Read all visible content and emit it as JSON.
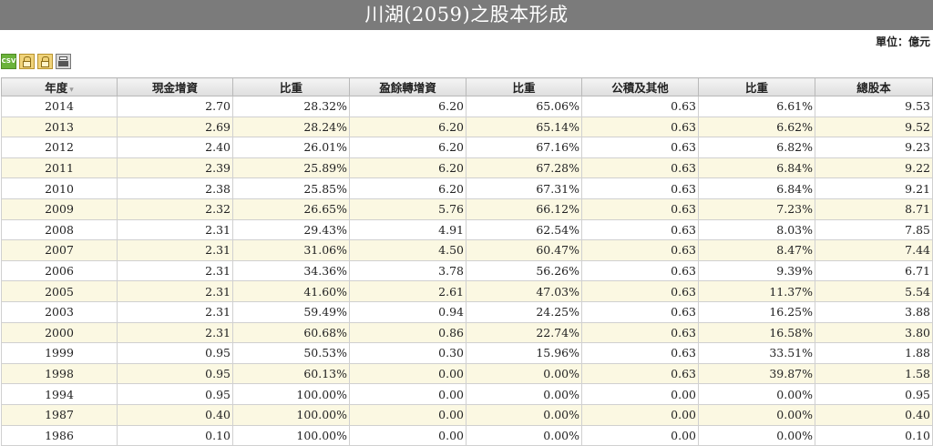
{
  "title": "川湖(2059)之股本形成",
  "unit": "單位：億元",
  "toolbar": {
    "csv_label": "CSV"
  },
  "columns": [
    "年度",
    "現金增資",
    "比重",
    "盈餘轉增資",
    "比重",
    "公積及其他",
    "比重",
    "總股本"
  ],
  "rows": [
    [
      "2014",
      "2.70",
      "28.32%",
      "6.20",
      "65.06%",
      "0.63",
      "6.61%",
      "9.53"
    ],
    [
      "2013",
      "2.69",
      "28.24%",
      "6.20",
      "65.14%",
      "0.63",
      "6.62%",
      "9.52"
    ],
    [
      "2012",
      "2.40",
      "26.01%",
      "6.20",
      "67.16%",
      "0.63",
      "6.82%",
      "9.23"
    ],
    [
      "2011",
      "2.39",
      "25.89%",
      "6.20",
      "67.28%",
      "0.63",
      "6.84%",
      "9.22"
    ],
    [
      "2010",
      "2.38",
      "25.85%",
      "6.20",
      "67.31%",
      "0.63",
      "6.84%",
      "9.21"
    ],
    [
      "2009",
      "2.32",
      "26.65%",
      "5.76",
      "66.12%",
      "0.63",
      "7.23%",
      "8.71"
    ],
    [
      "2008",
      "2.31",
      "29.43%",
      "4.91",
      "62.54%",
      "0.63",
      "8.03%",
      "7.85"
    ],
    [
      "2007",
      "2.31",
      "31.06%",
      "4.50",
      "60.47%",
      "0.63",
      "8.47%",
      "7.44"
    ],
    [
      "2006",
      "2.31",
      "34.36%",
      "3.78",
      "56.26%",
      "0.63",
      "9.39%",
      "6.71"
    ],
    [
      "2005",
      "2.31",
      "41.60%",
      "2.61",
      "47.03%",
      "0.63",
      "11.37%",
      "5.54"
    ],
    [
      "2003",
      "2.31",
      "59.49%",
      "0.94",
      "24.25%",
      "0.63",
      "16.25%",
      "3.88"
    ],
    [
      "2000",
      "2.31",
      "60.68%",
      "0.86",
      "22.74%",
      "0.63",
      "16.58%",
      "3.80"
    ],
    [
      "1999",
      "0.95",
      "50.53%",
      "0.30",
      "15.96%",
      "0.63",
      "33.51%",
      "1.88"
    ],
    [
      "1998",
      "0.95",
      "60.13%",
      "0.00",
      "0.00%",
      "0.63",
      "39.87%",
      "1.58"
    ],
    [
      "1994",
      "0.95",
      "100.00%",
      "0.00",
      "0.00%",
      "0.00",
      "0.00%",
      "0.95"
    ],
    [
      "1987",
      "0.40",
      "100.00%",
      "0.00",
      "0.00%",
      "0.00",
      "0.00%",
      "0.40"
    ],
    [
      "1986",
      "0.10",
      "100.00%",
      "0.00",
      "0.00%",
      "0.00",
      "0.00%",
      "0.10"
    ]
  ]
}
